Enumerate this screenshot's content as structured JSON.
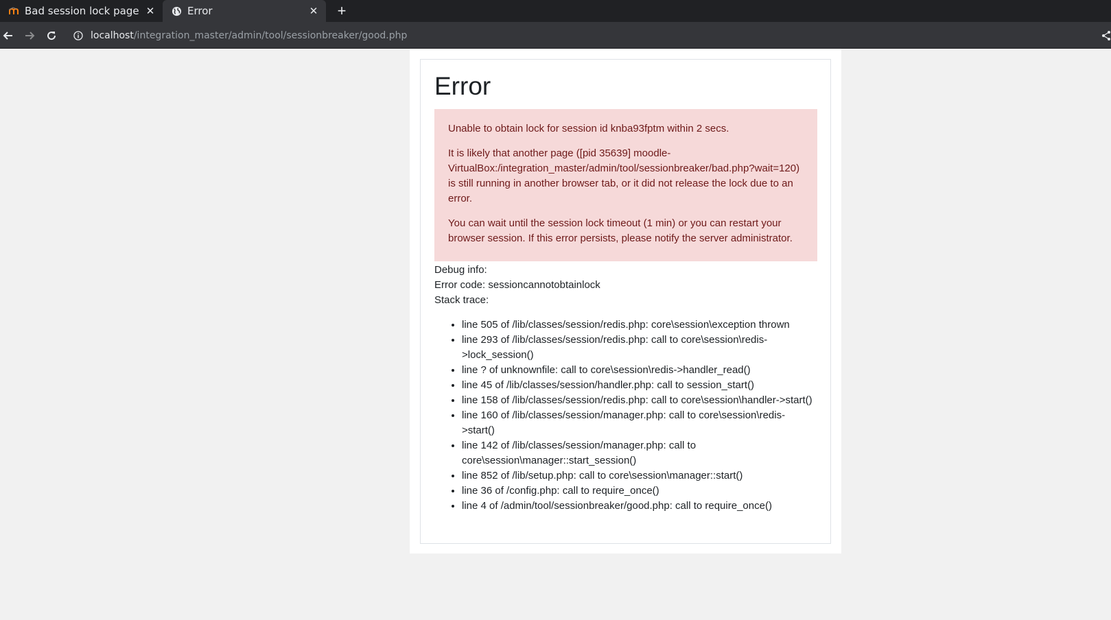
{
  "browser": {
    "tabs": [
      {
        "title": "Bad session lock page",
        "favicon": "moodle-favicon",
        "active": false
      },
      {
        "title": "Error",
        "favicon": "globe-icon",
        "active": true
      }
    ],
    "url_host": "localhost",
    "url_path": "/integration_master/admin/tool/sessionbreaker/good.php"
  },
  "page": {
    "heading": "Error",
    "alert_paragraphs": [
      "Unable to obtain lock for session id knba93fptm within 2 secs.",
      "It is likely that another page ([pid 35639] moodle-VirtualBox:/integration_master/admin/tool/sessionbreaker/bad.php?wait=120) is still running in another browser tab, or it did not release the lock due to an error.",
      "You can wait until the session lock timeout (1 min) or you can restart your browser session. If this error persists, please notify the server administrator."
    ],
    "debug_info": "Debug info:",
    "error_code": "Error code: sessioncannotobtainlock",
    "stack_trace_label": "Stack trace:",
    "stack_trace": [
      "line 505 of /lib/classes/session/redis.php: core\\session\\exception thrown",
      "line 293 of /lib/classes/session/redis.php: call to core\\session\\redis->lock_session()",
      "line ? of unknownfile: call to core\\session\\redis->handler_read()",
      "line 45 of /lib/classes/session/handler.php: call to session_start()",
      "line 158 of /lib/classes/session/redis.php: call to core\\session\\handler->start()",
      "line 160 of /lib/classes/session/manager.php: call to core\\session\\redis->start()",
      "line 142 of /lib/classes/session/manager.php: call to core\\session\\manager::start_session()",
      "line 852 of /lib/setup.php: call to core\\session\\manager::start()",
      "line 36 of /config.php: call to require_once()",
      "line 4 of /admin/tool/sessionbreaker/good.php: call to require_once()"
    ]
  },
  "colors": {
    "alert_bg": "#f6d9d9",
    "alert_text": "#6e1a1a",
    "chrome_dark": "#202124",
    "chrome_toolbar": "#35363a"
  }
}
